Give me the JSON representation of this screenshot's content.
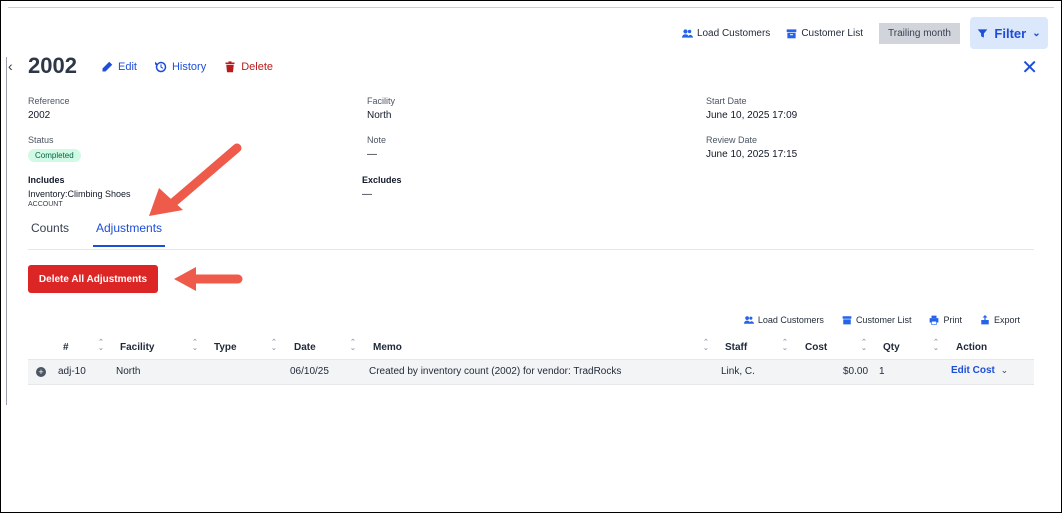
{
  "toolbar": {
    "load_customers": "Load Customers",
    "customer_list": "Customer List",
    "range": "Trailing month",
    "filter": "Filter"
  },
  "header": {
    "title": "2002",
    "edit": "Edit",
    "history": "History",
    "delete": "Delete"
  },
  "details": {
    "reference_label": "Reference",
    "reference": "2002",
    "facility_label": "Facility",
    "facility": "North",
    "start_label": "Start Date",
    "start": "June 10, 2025 17:09",
    "status_label": "Status",
    "status": "Completed",
    "note_label": "Note",
    "note": "—",
    "review_label": "Review Date",
    "review": "June 10, 2025 17:15",
    "includes_label": "Includes",
    "includes_item": "Inventory:Climbing Shoes",
    "includes_type": "ACCOUNT",
    "excludes_label": "Excludes",
    "excludes": "—"
  },
  "tabs": {
    "counts": "Counts",
    "adjustments": "Adjustments"
  },
  "delete_all": "Delete All Adjustments",
  "table_tools": {
    "load_customers": "Load Customers",
    "customer_list": "Customer List",
    "print": "Print",
    "export": "Export"
  },
  "columns": {
    "num": "#",
    "facility": "Facility",
    "type": "Type",
    "date": "Date",
    "memo": "Memo",
    "staff": "Staff",
    "cost": "Cost",
    "qty": "Qty",
    "action": "Action"
  },
  "rows": [
    {
      "num": "adj-10",
      "facility": "North",
      "type": "",
      "date": "06/10/25",
      "memo": "Created by inventory count (2002) for vendor: TradRocks",
      "staff": "Link, C.",
      "cost": "$0.00",
      "qty": "1",
      "action": "Edit Cost"
    }
  ],
  "colors": {
    "primary": "#1d4ed8",
    "danger": "#dc2626",
    "success_bg": "#d1fae5",
    "annotation_arrow": "#ef5b4a"
  }
}
